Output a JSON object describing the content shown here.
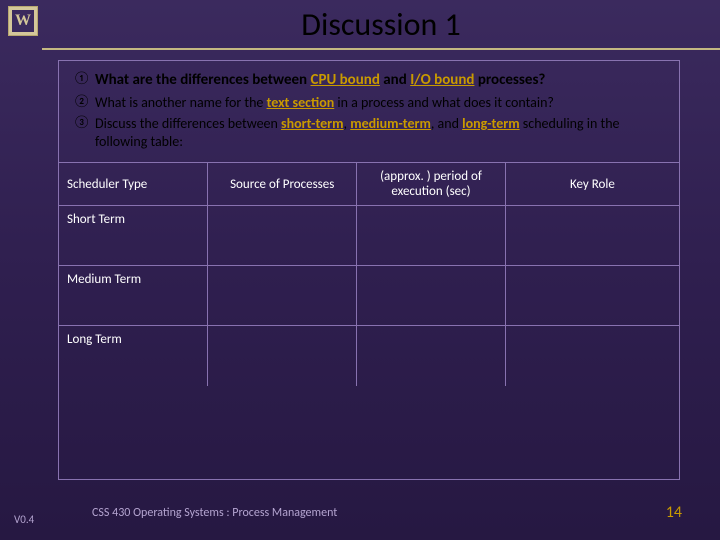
{
  "logo_letter": "W",
  "title": "Discussion 1",
  "questions": [
    {
      "num": "①",
      "bold": true,
      "parts": [
        {
          "t": "What are the differences between ",
          "hl": false
        },
        {
          "t": "CPU bound",
          "hl": true
        },
        {
          "t": " and ",
          "hl": false
        },
        {
          "t": "I/O bound",
          "hl": true
        },
        {
          "t": " processes?",
          "hl": false
        }
      ]
    },
    {
      "num": "②",
      "bold": false,
      "parts": [
        {
          "t": "What is another name for the ",
          "hl": false
        },
        {
          "t": "text section",
          "hl": true,
          "bold": true
        },
        {
          "t": " in a process and what does it contain?",
          "hl": false
        }
      ]
    },
    {
      "num": "③",
      "bold": false,
      "parts": [
        {
          "t": "Discuss the differences between ",
          "hl": false
        },
        {
          "t": "short-term",
          "hl": true,
          "bold": true
        },
        {
          "t": ", ",
          "hl": false
        },
        {
          "t": "medium-term",
          "hl": true,
          "bold": true
        },
        {
          "t": ", and ",
          "hl": false
        },
        {
          "t": "long-term",
          "hl": true,
          "bold": true
        },
        {
          "t": " scheduling in the following table:",
          "hl": false
        }
      ]
    }
  ],
  "table": {
    "headers": [
      "Scheduler Type",
      "Source of Processes",
      "(approx. ) period of execution (sec)",
      "Key Role"
    ],
    "rows": [
      [
        "Short Term",
        "",
        "",
        ""
      ],
      [
        "Medium Term",
        "",
        "",
        ""
      ],
      [
        "Long Term",
        "",
        "",
        ""
      ]
    ]
  },
  "footer": {
    "version": "V0.4",
    "course": "CSS 430 Operating Systems : Process Management",
    "page": "14"
  }
}
